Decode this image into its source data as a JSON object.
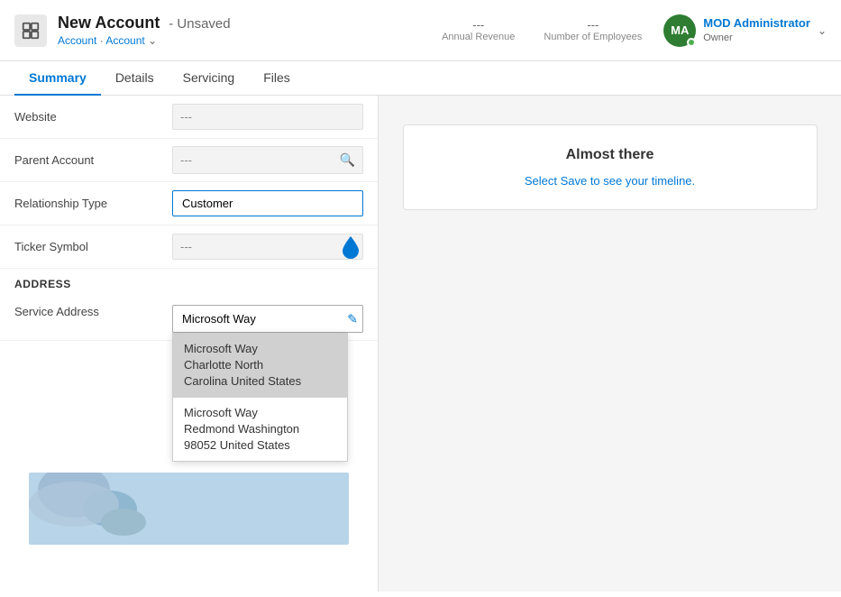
{
  "header": {
    "title": "New Account",
    "unsaved_label": "- Unsaved",
    "breadcrumb_root": "Account",
    "breadcrumb_entity": "Account",
    "annual_revenue_value": "---",
    "annual_revenue_label": "Annual Revenue",
    "num_employees_value": "---",
    "num_employees_label": "Number of Employees",
    "user_initials": "MA",
    "user_name": "MOD Administrator",
    "user_role": "Owner",
    "icon_label": "account-icon"
  },
  "tabs": [
    {
      "label": "Summary",
      "active": true
    },
    {
      "label": "Details",
      "active": false
    },
    {
      "label": "Servicing",
      "active": false
    },
    {
      "label": "Files",
      "active": false
    }
  ],
  "form": {
    "website_label": "Website",
    "website_value": "---",
    "parent_account_label": "Parent Account",
    "parent_account_value": "---",
    "relationship_type_label": "Relationship Type",
    "relationship_type_value": "Customer",
    "ticker_symbol_label": "Ticker Symbol",
    "ticker_symbol_value": "---"
  },
  "address": {
    "section_label": "ADDRESS",
    "service_address_label": "Service Address",
    "service_address_value": "Microsoft Way",
    "dropdown": [
      {
        "line1": "Microsoft Way",
        "line2": "Charlotte North",
        "line3": "Carolina United States"
      },
      {
        "line1": "Microsoft Way",
        "line2": "Redmond Washington",
        "line3": "98052 United States"
      }
    ]
  },
  "timeline": {
    "title": "Almost there",
    "subtitle": "Select Save to see your timeline."
  },
  "icons": {
    "search": "🔍",
    "edit": "✏",
    "chevron_down": "⌄",
    "water_drop": "💧"
  }
}
